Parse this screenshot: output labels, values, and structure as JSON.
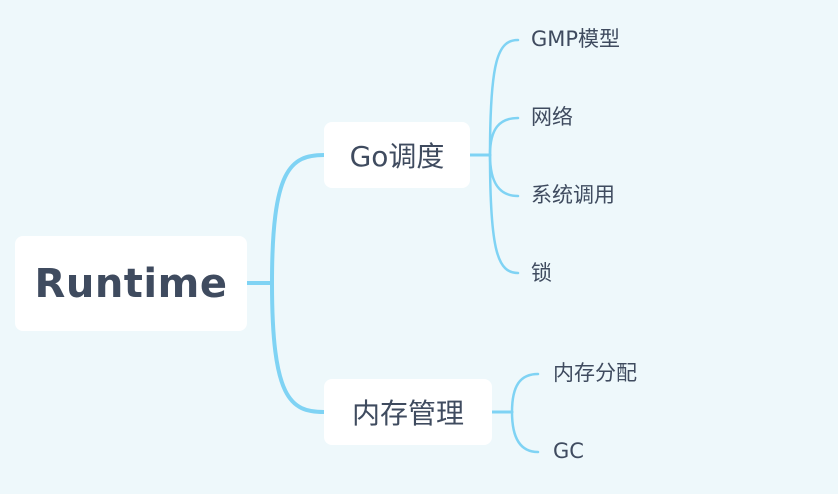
{
  "mindmap": {
    "root": {
      "label": "Runtime"
    },
    "branches": [
      {
        "label": "Go调度",
        "children": [
          "GMP模型",
          "网络",
          "系统调用",
          "锁"
        ]
      },
      {
        "label": "内存管理",
        "children": [
          "内存分配",
          "GC"
        ]
      }
    ]
  },
  "colors": {
    "background": "#eef8fb",
    "connector": "#7fd3f4",
    "node_fill": "#ffffff",
    "text": "#3f4b5f"
  }
}
